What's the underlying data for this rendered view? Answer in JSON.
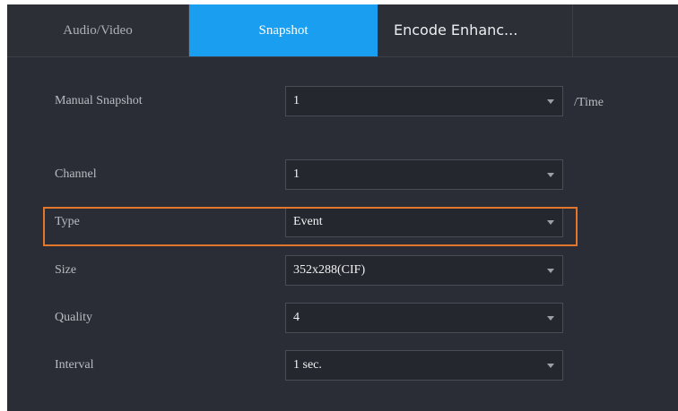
{
  "tabs": [
    {
      "label": "Audio/Video",
      "active": false
    },
    {
      "label": "Snapshot",
      "active": true
    },
    {
      "label": "Encode Enhanc...",
      "active": false
    }
  ],
  "manual_snapshot": {
    "label": "Manual Snapshot",
    "value": "1",
    "suffix": "/Time"
  },
  "channel": {
    "label": "Channel",
    "value": "1"
  },
  "type": {
    "label": "Type",
    "value": "Event"
  },
  "size": {
    "label": "Size",
    "value": "352x288(CIF)"
  },
  "quality": {
    "label": "Quality",
    "value": "4"
  },
  "interval": {
    "label": "Interval",
    "value": "1 sec."
  },
  "colors": {
    "active_tab": "#1a9ff0",
    "highlight": "#e2762c",
    "background": "#2a2d35"
  }
}
